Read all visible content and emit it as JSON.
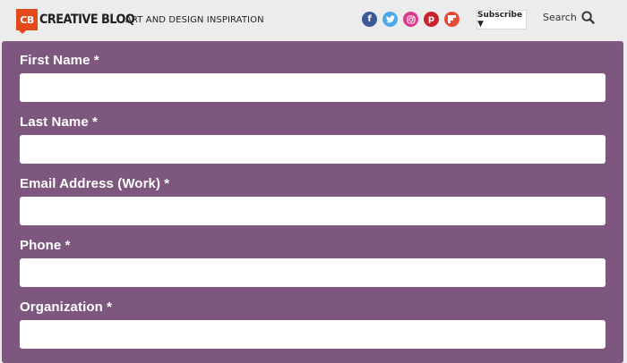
{
  "header": {
    "logo_badge": "CB",
    "logo_text": "CREATIVE BLOQ",
    "tagline": "ART AND DESIGN INSPIRATION",
    "social": [
      {
        "name": "facebook-icon",
        "glyph": "f"
      },
      {
        "name": "twitter-icon",
        "glyph": "t"
      },
      {
        "name": "instagram-icon",
        "glyph": "◎"
      },
      {
        "name": "pinterest-icon",
        "glyph": "p"
      },
      {
        "name": "flipboard-icon",
        "glyph": "f"
      }
    ],
    "subscribe_label": "Subscribe ▼",
    "search_label": "Search"
  },
  "form": {
    "fields": [
      {
        "label": "First Name *",
        "value": "",
        "placeholder": ""
      },
      {
        "label": "Last Name *",
        "value": "",
        "placeholder": ""
      },
      {
        "label": "Email Address (Work) *",
        "value": "",
        "placeholder": ""
      },
      {
        "label": "Phone *",
        "value": "",
        "placeholder": ""
      },
      {
        "label": "Organization *",
        "value": "",
        "placeholder": ""
      }
    ]
  },
  "colors": {
    "panel": "#7e577f",
    "brand": "#e24a1b"
  }
}
